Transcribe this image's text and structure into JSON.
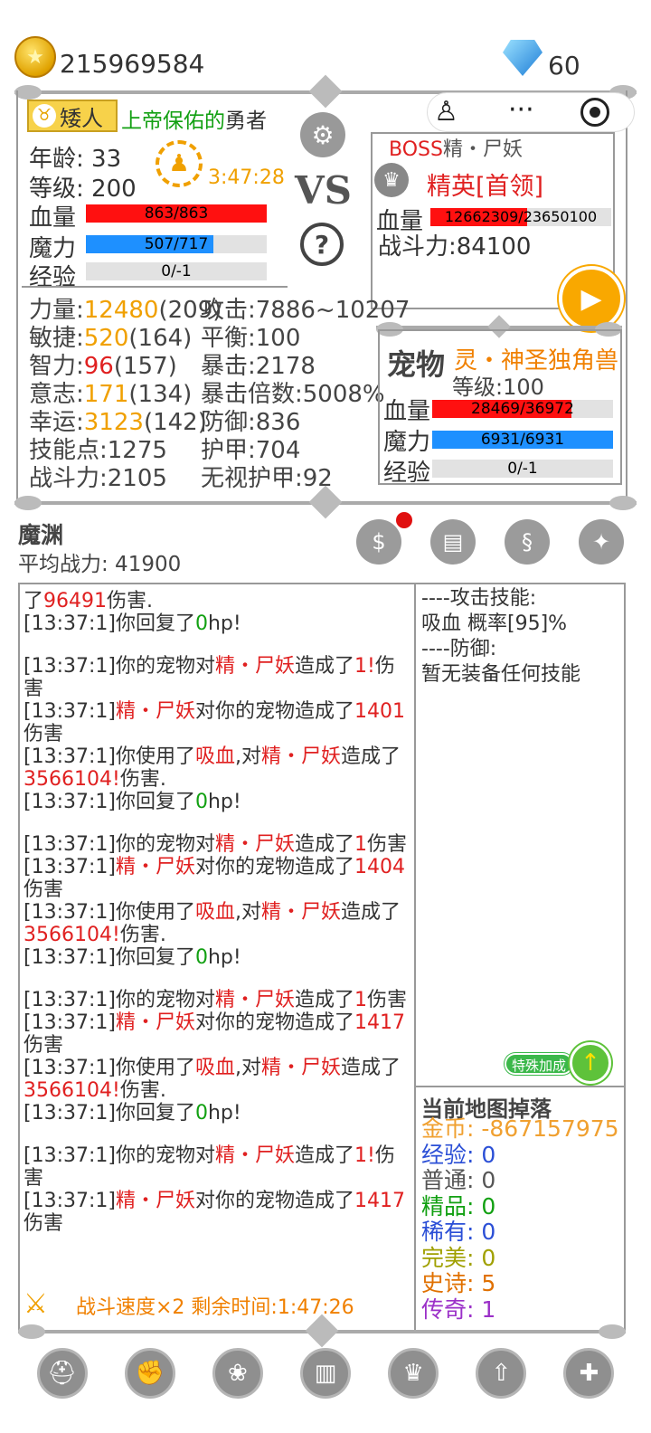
{
  "currency": {
    "gold": "215969584",
    "diamonds": "60"
  },
  "player": {
    "race": "矮人",
    "title_green": "上帝保佑的",
    "title_rest": "勇者",
    "age_label": "年龄:",
    "age": "33",
    "level_label": "等级:",
    "level": "200",
    "timer": "3:47:28",
    "hp_label": "血量",
    "hp_text": "863/863",
    "hp_ratio": 1.0,
    "mp_label": "魔力",
    "mp_text": "507/717",
    "mp_ratio": 0.707,
    "exp_label": "经验",
    "exp_text": "0/-1",
    "exp_ratio": 0,
    "stats_left": [
      {
        "label": "力量:",
        "value": "12480",
        "extra": "(209)"
      },
      {
        "label": "敏捷:",
        "value": "520",
        "extra": "(164)"
      },
      {
        "label": "智力:",
        "value": "96",
        "extra": "(157)"
      },
      {
        "label": "意志:",
        "value": "171",
        "extra": "(134)"
      },
      {
        "label": "幸运:",
        "value": "3123",
        "extra": "(142)"
      },
      {
        "label": "技能点:1275",
        "value": "",
        "extra": ""
      },
      {
        "label": "战斗力:2105",
        "value": "",
        "extra": ""
      }
    ],
    "stats_right": [
      "攻击:7886~10207",
      "平衡:100",
      "暴击:2178",
      "暴击倍数:5008%",
      "防御:836",
      "护甲:704",
      "无视护甲:92"
    ]
  },
  "vs": {
    "label": "VS",
    "help": "?"
  },
  "boss": {
    "tag": "BOSS",
    "name": "精・尸妖",
    "rank": "精英[首领]",
    "hp_label": "血量",
    "hp_text": "12662309/23650100",
    "hp_ratio": 0.535,
    "power": "战斗力:84100"
  },
  "pet": {
    "label": "宠物",
    "name": "灵・神圣独角兽",
    "level": "等级:100",
    "hp_label": "血量",
    "hp_text": "28469/36972",
    "hp_ratio": 0.77,
    "mp_label": "魔力",
    "mp_text": "6931/6931",
    "mp_ratio": 1.0,
    "exp_label": "经验",
    "exp_text": "0/-1",
    "exp_ratio": 0
  },
  "area": {
    "name": "魔渊",
    "avg_power": "平均战力: 41900"
  },
  "log": {
    "cut_line": {
      "pre": "了",
      "num": "96491",
      "post": "伤害."
    },
    "blocks": [
      [
        {
          "t": "[13:37:1]你回复了",
          "v": "0",
          "e": "hp!"
        }
      ],
      [
        {
          "t": "[13:37:1]你的宠物对",
          "n": "精・尸妖",
          "m": "造成了",
          "v": "1!",
          "e": "伤害"
        },
        {
          "t": "[13:37:1]",
          "n": "精・尸妖",
          "m": "对你的宠物造成了",
          "v": "1401",
          "e": "伤害"
        },
        {
          "t": "[13:37:1]你使用了",
          "s": "吸血",
          "m2": ",对",
          "n": "精・尸妖",
          "m": "造成了",
          "v": "3566104!",
          "e": "伤害."
        },
        {
          "t": "[13:37:1]你回复了",
          "v": "0",
          "e": "hp!"
        }
      ],
      [
        {
          "t": "[13:37:1]你的宠物对",
          "n": "精・尸妖",
          "m": "造成了",
          "v": "1",
          "e": "伤害"
        },
        {
          "t": "[13:37:1]",
          "n": "精・尸妖",
          "m": "对你的宠物造成了",
          "v": "1404",
          "e": "伤害"
        },
        {
          "t": "[13:37:1]你使用了",
          "s": "吸血",
          "m2": ",对",
          "n": "精・尸妖",
          "m": "造成了",
          "v": "3566104!",
          "e": "伤害."
        },
        {
          "t": "[13:37:1]你回复了",
          "v": "0",
          "e": "hp!"
        }
      ],
      [
        {
          "t": "[13:37:1]你的宠物对",
          "n": "精・尸妖",
          "m": "造成了",
          "v": "1",
          "e": "伤害"
        },
        {
          "t": "[13:37:1]",
          "n": "精・尸妖",
          "m": "对你的宠物造成了",
          "v": "1417",
          "e": "伤害"
        },
        {
          "t": "[13:37:1]你使用了",
          "s": "吸血",
          "m2": ",对",
          "n": "精・尸妖",
          "m": "造成了",
          "v": "3566104!",
          "e": "伤害."
        },
        {
          "t": "[13:37:1]你回复了",
          "v": "0",
          "e": "hp!"
        }
      ],
      [
        {
          "t": "[13:37:1]你的宠物对",
          "n": "精・尸妖",
          "m": "造成了",
          "v": "1!",
          "e": "伤害"
        },
        {
          "t": "[13:37:1]",
          "n": "精・尸妖",
          "m": "对你的宠物造成了",
          "v": "1417",
          "e": "伤害"
        }
      ]
    ],
    "speed": "战斗速度×2 剩余时间:1:47:26"
  },
  "skills": {
    "attack_header": "----攻击技能:",
    "attack_skill": "吸血 概率[95]%",
    "defense_header": "----防御:",
    "defense_skill": "暂无装备任何技能",
    "bonus": "特殊加成"
  },
  "drops": {
    "title": "当前地图掉落",
    "items": [
      {
        "label": "金币: ",
        "value": "-867157975",
        "color": "#f0a030"
      },
      {
        "label": "经验: ",
        "value": "0",
        "color": "#2b4fd6"
      },
      {
        "label": "普通: ",
        "value": "0",
        "color": "#555555"
      },
      {
        "label": "精品: ",
        "value": "0",
        "color": "#12a012"
      },
      {
        "label": "稀有: ",
        "value": "0",
        "color": "#2b4fd6"
      },
      {
        "label": "完美: ",
        "value": "0",
        "color": "#a0a000"
      },
      {
        "label": "史诗: ",
        "value": "5",
        "color": "#e07000"
      },
      {
        "label": "传奇: ",
        "value": "1",
        "color": "#9b30c8"
      }
    ]
  },
  "icons": {
    "shop": "shop-icon",
    "map": "map-icon",
    "scroll": "scroll-icon",
    "muscle": "muscle-icon",
    "bottom": [
      "helmet-icon",
      "fist-icon",
      "paw-icon",
      "book-icon",
      "crown-icon",
      "upgrade-icon",
      "plus-icon"
    ]
  }
}
